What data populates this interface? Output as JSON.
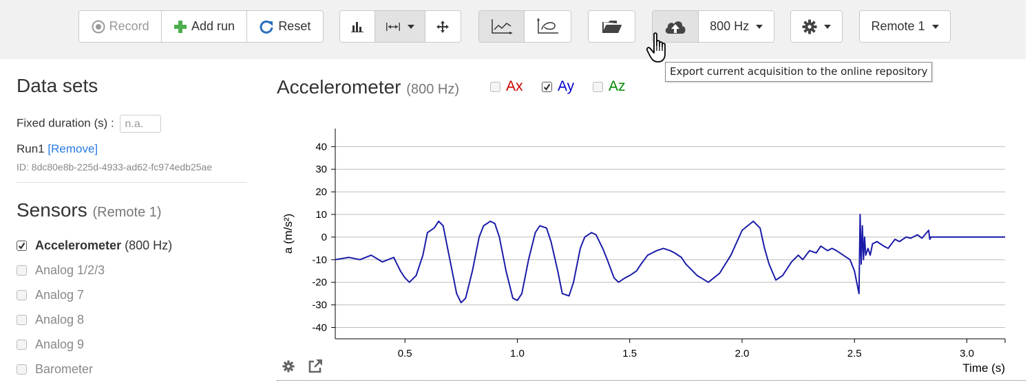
{
  "toolbar": {
    "record_label": "Record",
    "add_run_label": "Add run",
    "reset_label": "Reset",
    "frequency_label": "800 Hz",
    "remote_label": "Remote 1",
    "tooltip": "Export current acquisition to the online repository"
  },
  "datasets": {
    "title": "Data sets",
    "fixed_duration_label": "Fixed duration (s) :",
    "fixed_duration_value": "n.a.",
    "run_name": "Run1",
    "remove_label": "[Remove]",
    "run_id": "ID: 8dc80e8b-225d-4933-ad62-fc974edb25ae"
  },
  "sensors": {
    "title": "Sensors",
    "remote": "(Remote 1)",
    "items": [
      {
        "label": "Accelerometer",
        "extra": "(800 Hz)",
        "checked": true
      },
      {
        "label": "Analog 1/2/3",
        "checked": false
      },
      {
        "label": "Analog 7",
        "checked": false
      },
      {
        "label": "Analog 8",
        "checked": false
      },
      {
        "label": "Analog 9",
        "checked": false
      },
      {
        "label": "Barometer",
        "checked": false
      }
    ]
  },
  "plot": {
    "title": "Accelerometer",
    "rate": "(800 Hz)",
    "axes": [
      {
        "label": "Ax",
        "checked": false,
        "color": "#cc0000"
      },
      {
        "label": "Ay",
        "checked": true,
        "color": "#0000cc"
      },
      {
        "label": "Az",
        "checked": false,
        "color": "#008800"
      }
    ]
  },
  "chart_data": {
    "type": "line",
    "xlabel": "Time (s)",
    "ylabel": "a (m/s²)",
    "xlim": [
      0.19,
      3.17
    ],
    "ylim": [
      -45,
      48
    ],
    "xticks": [
      0.5,
      1.0,
      1.5,
      2.0,
      2.5,
      3.0
    ],
    "xtick_labels": [
      "0.5",
      "1.0",
      "1.5",
      "2.0",
      "2.5",
      "3.0"
    ],
    "yticks": [
      40,
      30,
      20,
      10,
      0,
      -10,
      -20,
      -30,
      -40
    ],
    "grid": true,
    "series": [
      {
        "color": "#1a1aa8",
        "x": [
          0.19,
          0.25,
          0.3,
          0.35,
          0.4,
          0.45,
          0.48,
          0.5,
          0.52,
          0.55,
          0.58,
          0.6,
          0.63,
          0.65,
          0.67,
          0.7,
          0.73,
          0.75,
          0.77,
          0.8,
          0.83,
          0.85,
          0.88,
          0.9,
          0.92,
          0.95,
          0.98,
          1.0,
          1.02,
          1.05,
          1.08,
          1.1,
          1.13,
          1.15,
          1.18,
          1.2,
          1.23,
          1.25,
          1.28,
          1.3,
          1.33,
          1.35,
          1.38,
          1.4,
          1.43,
          1.45,
          1.48,
          1.5,
          1.53,
          1.55,
          1.58,
          1.6,
          1.62,
          1.65,
          1.68,
          1.7,
          1.73,
          1.75,
          1.78,
          1.8,
          1.85,
          1.9,
          1.95,
          2.0,
          2.05,
          2.08,
          2.1,
          2.12,
          2.15,
          2.18,
          2.2,
          2.22,
          2.25,
          2.27,
          2.3,
          2.33,
          2.35,
          2.38,
          2.4,
          2.42,
          2.45,
          2.48,
          2.5,
          2.52,
          2.525,
          2.53,
          2.535,
          2.54,
          2.545,
          2.55,
          2.56,
          2.57,
          2.58,
          2.6,
          2.63,
          2.65,
          2.68,
          2.7,
          2.73,
          2.75,
          2.78,
          2.8,
          2.83,
          2.835,
          2.84,
          2.85,
          2.87,
          2.9,
          3.0,
          3.1,
          3.17
        ],
        "y": [
          -10,
          -9,
          -10,
          -8,
          -11,
          -9,
          -15,
          -18,
          -20,
          -17,
          -8,
          2,
          4,
          7,
          5,
          -10,
          -25,
          -29,
          -27,
          -15,
          0,
          5,
          7,
          6,
          0,
          -15,
          -27,
          -28,
          -25,
          -10,
          2,
          5,
          4,
          -2,
          -15,
          -25,
          -26,
          -20,
          -5,
          0,
          2,
          1,
          -5,
          -10,
          -18,
          -20,
          -18,
          -17,
          -15,
          -12,
          -8,
          -7,
          -6,
          -5,
          -6,
          -7,
          -9,
          -12,
          -15,
          -17,
          -20,
          -16,
          -8,
          3,
          7,
          4,
          -5,
          -12,
          -19,
          -17,
          -14,
          -11,
          -8,
          -10,
          -6,
          -7,
          -4,
          -6,
          -5,
          -6,
          -8,
          -10,
          -15,
          -25,
          10,
          -12,
          5,
          -10,
          0,
          -8,
          -5,
          -8,
          -3,
          -2,
          -4,
          -5,
          -1,
          -2,
          0,
          -0.5,
          1,
          -0.5,
          3,
          -1,
          0,
          0,
          0,
          0,
          0,
          0,
          0
        ]
      }
    ]
  }
}
